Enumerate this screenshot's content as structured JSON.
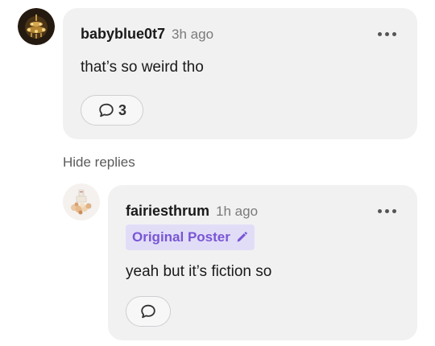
{
  "comments": [
    {
      "username": "babyblue0t7",
      "time": "3h ago",
      "text": "that’s so weird tho",
      "reply_count": "3",
      "avatar_icon": "chandelier-avatar-icon"
    }
  ],
  "hide_replies_label": "Hide replies",
  "replies": [
    {
      "username": "fairiesthrum",
      "time": "1h ago",
      "badge": "Original Poster",
      "badge_icon": "pencil-icon",
      "text": "yeah but it’s fiction so",
      "avatar_icon": "cake-avatar-icon"
    }
  ],
  "colors": {
    "bubble": "#f1f1f2",
    "badge_bg": "#e2ddf7",
    "badge_text": "#7856d6",
    "muted_text": "#7a7a7a"
  },
  "icons": {
    "more": "more-horizontal-icon",
    "reply": "speech-bubble-icon"
  }
}
